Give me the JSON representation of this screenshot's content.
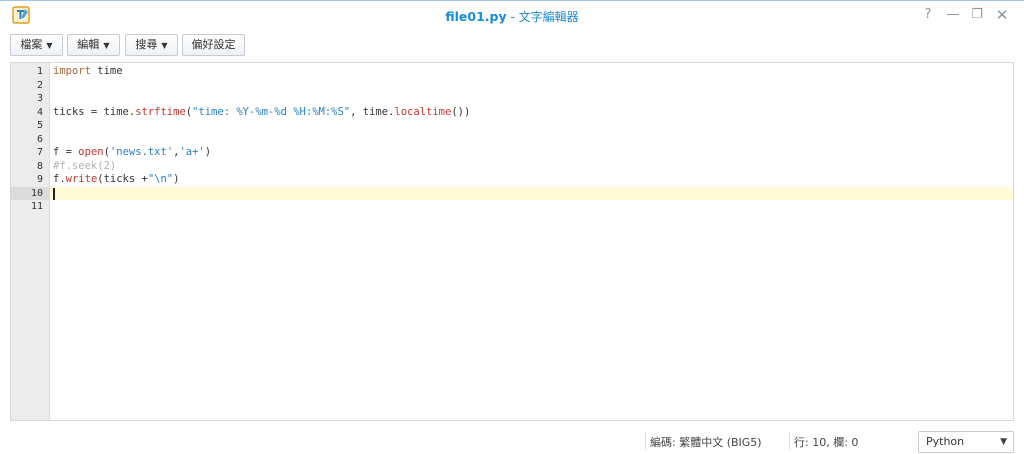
{
  "window": {
    "file_name": "file01.py",
    "separator": " - ",
    "app_name": "文字編輯器",
    "controls": {
      "help": "?",
      "minimize": "—",
      "restore": "❐",
      "close": "✕"
    }
  },
  "toolbar": {
    "file_label": "檔案",
    "edit_label": "編輯",
    "search_label": "搜尋",
    "prefs_label": "偏好設定"
  },
  "editor": {
    "active_line": 10,
    "lines": [
      {
        "num": "1",
        "text": "import time"
      },
      {
        "num": "2",
        "text": ""
      },
      {
        "num": "3",
        "text": ""
      },
      {
        "num": "4",
        "text": "ticks = time.strftime(\"time: %Y-%m-%d %H:%M:%S\", time.localtime())"
      },
      {
        "num": "5",
        "text": ""
      },
      {
        "num": "6",
        "text": ""
      },
      {
        "num": "7",
        "text": "f = open('news.txt','a+')"
      },
      {
        "num": "8",
        "text": "#f.seek(2)"
      },
      {
        "num": "9",
        "text": "f.write(ticks +\"\\n\")"
      },
      {
        "num": "10",
        "text": ""
      },
      {
        "num": "11",
        "text": ""
      }
    ]
  },
  "status": {
    "encoding": "編碼: 繁體中文 (BIG5)",
    "position": "行: 10, 欄: 0",
    "language": "Python"
  },
  "colors": {
    "title_blue": "#1a8bd6",
    "keyword": "#a0673a",
    "function": "#c0392b",
    "string": "#2a7fbe",
    "comment": "#b0b0b0",
    "active_line_bg": "#fffbd6"
  }
}
